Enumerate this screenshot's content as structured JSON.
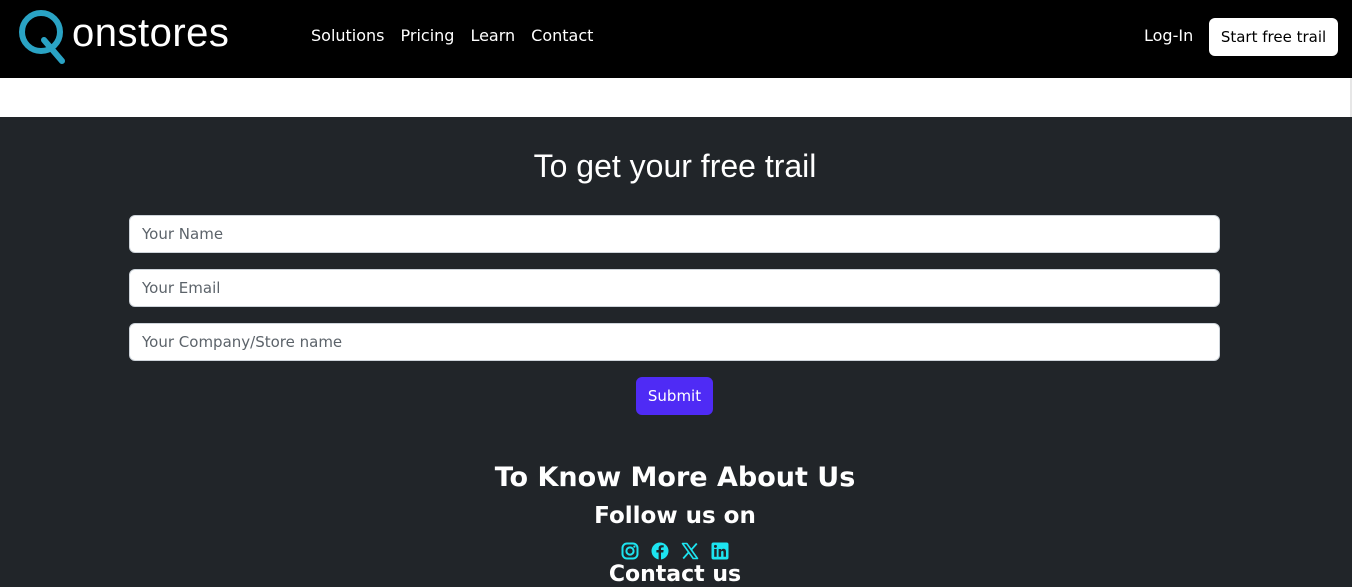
{
  "brand": {
    "text": "onstores",
    "logo_icon": "q-logo-icon",
    "accent": "#2aa3c4"
  },
  "nav": {
    "links": [
      "Solutions",
      "Pricing",
      "Learn",
      "Contact"
    ],
    "login": "Log-In",
    "start_trial": "Start free trail"
  },
  "form": {
    "title": "To get your free trail",
    "name_placeholder": "Your Name",
    "email_placeholder": "Your Email",
    "company_placeholder": "Your Company/Store name",
    "submit": "Submit",
    "submit_color": "#4f2bf5"
  },
  "about": {
    "title": "To Know More About Us",
    "follow": "Follow us on",
    "socials": [
      "instagram-icon",
      "facebook-icon",
      "x-twitter-icon",
      "linkedin-icon"
    ],
    "social_color": "#1de4f0",
    "cutoff_text": "Contact us"
  },
  "colors": {
    "navbar": "#000000",
    "section_bg": "#212529"
  }
}
